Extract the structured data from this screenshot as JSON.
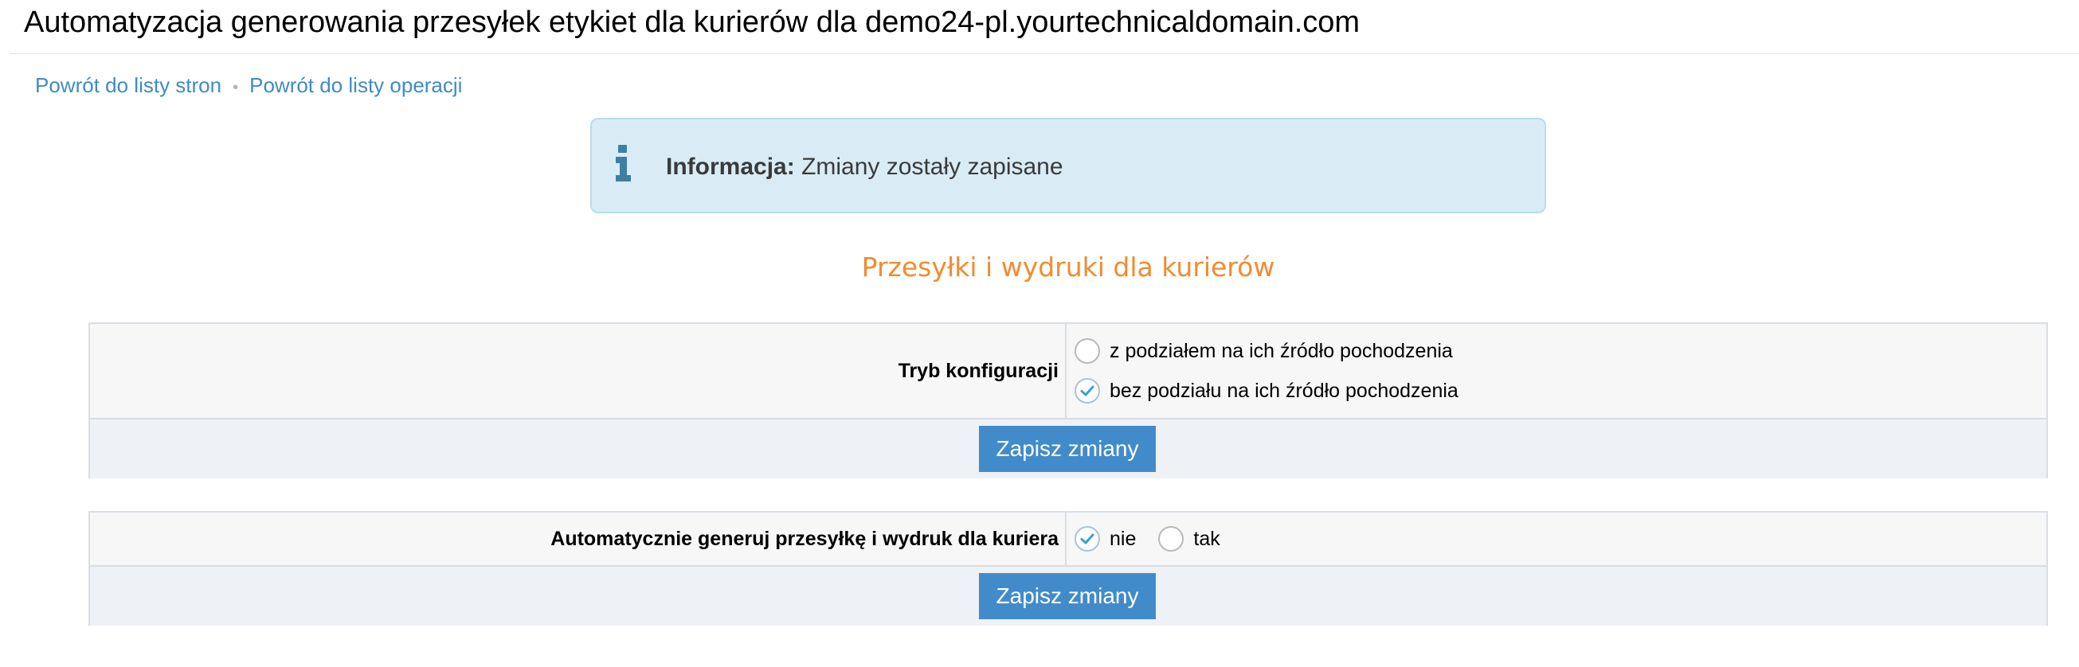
{
  "page": {
    "title": "Automatyzacja generowania przesyłek etykiet dla kurierów dla demo24-pl.yourtechnicaldomain.com"
  },
  "breadcrumbs": {
    "back_to_sites": "Powrót do listy stron",
    "separator": "•",
    "back_to_operations": "Powrót do listy operacji"
  },
  "notice": {
    "icon": "info-icon",
    "label": "Informacja:",
    "message": "Zmiany zostały zapisane"
  },
  "section": {
    "heading": "Przesyłki i wydruki dla kurierów"
  },
  "config_mode": {
    "label": "Tryb konfiguracji",
    "options": [
      {
        "label": "z podziałem na ich źródło pochodzenia",
        "checked": false
      },
      {
        "label": "bez podziału na ich źródło pochodzenia",
        "checked": true
      }
    ],
    "save_label": "Zapisz zmiany"
  },
  "auto_generate": {
    "label": "Automatycznie generuj przesyłkę i wydruk dla kuriera",
    "options": [
      {
        "label": "nie",
        "checked": true
      },
      {
        "label": "tak",
        "checked": false
      }
    ],
    "save_label": "Zapisz zmiany"
  },
  "colors": {
    "link": "#3f8bc4",
    "heading_accent": "#f28b30",
    "notice_bg": "#d9ecf6",
    "button": "#428bca",
    "check": "#3aa0d0"
  }
}
